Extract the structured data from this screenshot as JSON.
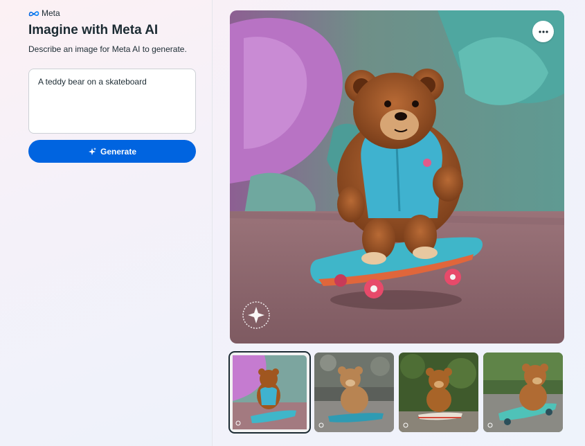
{
  "brand": {
    "name": "Meta"
  },
  "header": {
    "title": "Imagine with Meta AI",
    "subtitle": "Describe an image for Meta AI to generate."
  },
  "prompt": {
    "value": "A teddy bear on a skateboard"
  },
  "generate_button": {
    "label": "Generate"
  },
  "colors": {
    "accent": "#0064e0",
    "text": "#1c2b33"
  },
  "gallery": {
    "selected_index": 0,
    "thumbnails": [
      {
        "name": "thumbnail-1",
        "scene": "graffiti wall"
      },
      {
        "name": "thumbnail-2",
        "scene": "street"
      },
      {
        "name": "thumbnail-3",
        "scene": "garden"
      },
      {
        "name": "thumbnail-4",
        "scene": "park"
      }
    ]
  },
  "watermark": {
    "icon": "imagined-with-ai-sparkle-icon"
  }
}
